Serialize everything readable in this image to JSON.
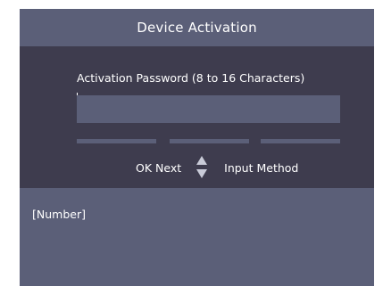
{
  "dialog": {
    "title": "Device Activation",
    "password_label": "Activation Password  (8 to 16 Characters)",
    "password_value": "",
    "hints": {
      "ok_next": "OK Next",
      "input_method": "Input Method"
    },
    "input_mode": "[Number]"
  },
  "colors": {
    "panel": "#3e3c4e",
    "title_bar": "#5b5f78",
    "text": "#ffffff"
  },
  "icons": {
    "up": "triangle-up",
    "down": "triangle-down"
  }
}
